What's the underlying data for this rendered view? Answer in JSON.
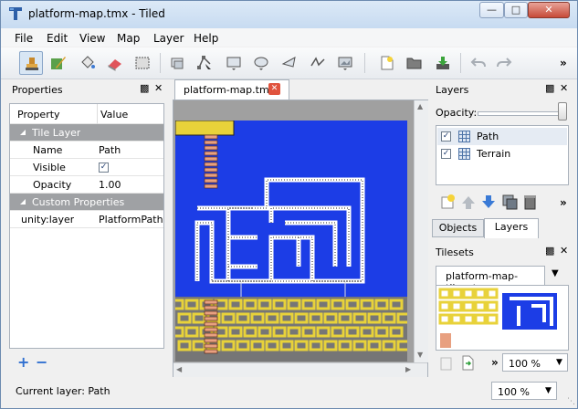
{
  "window": {
    "title": "platform-map.tmx - Tiled"
  },
  "menubar": {
    "items": [
      "File",
      "Edit",
      "View",
      "Map",
      "Layer",
      "Help"
    ]
  },
  "toolbar": {
    "tools": [
      "stamp-brush",
      "terrain-brush",
      "bucket-fill",
      "eraser",
      "rect-select",
      "select-objects",
      "edit-polygons",
      "insert-rectangle",
      "insert-ellipse",
      "insert-polygon",
      "insert-polyline",
      "insert-tile"
    ],
    "file_tools": [
      "new-file",
      "open-file",
      "save-file"
    ],
    "edit_tools": [
      "undo",
      "redo"
    ],
    "more": "»"
  },
  "properties": {
    "title": "Properties",
    "col_property": "Property",
    "col_value": "Value",
    "group_tile_layer": "Tile Layer",
    "rows": [
      {
        "name": "Name",
        "value": "Path"
      },
      {
        "name": "Visible",
        "value": ""
      },
      {
        "name": "Opacity",
        "value": "1.00"
      }
    ],
    "group_custom": "Custom Properties",
    "custom_rows": [
      {
        "name": "unity:layer",
        "value": "PlatformPath"
      }
    ]
  },
  "document": {
    "tab": "platform-map.tmx"
  },
  "layers": {
    "title": "Layers",
    "opacity_label": "Opacity:",
    "opacity": 1.0,
    "items": [
      {
        "name": "Path",
        "visible": true
      },
      {
        "name": "Terrain",
        "visible": true
      }
    ],
    "tabs": [
      "Objects",
      "Layers"
    ]
  },
  "tilesets": {
    "title": "Tilesets",
    "tab": "platform-map-tileset",
    "zoom": "100 %",
    "more": "»"
  },
  "status": {
    "current_layer": "Current layer: Path",
    "zoom": "100 %"
  },
  "colors": {
    "map_bg": "#1c3de6",
    "path_yellow": "#e8d23a",
    "titlebar": "#d5e4f6"
  }
}
